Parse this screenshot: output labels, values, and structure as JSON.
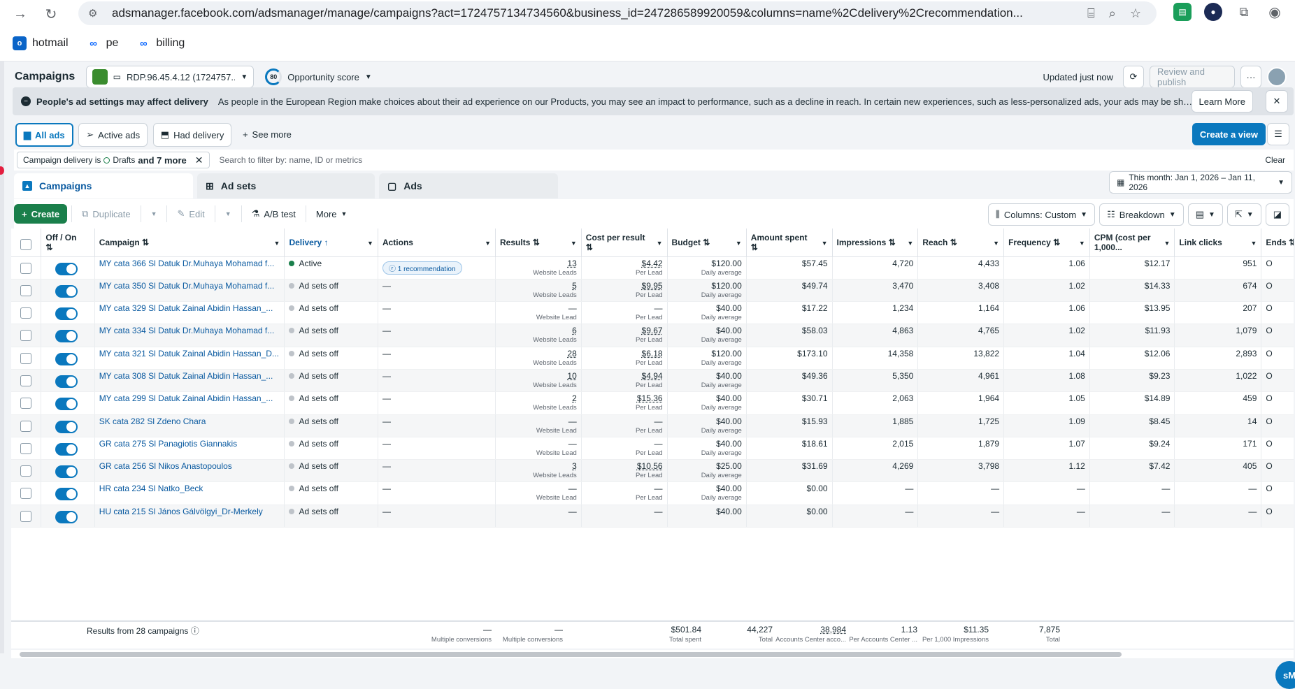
{
  "browser": {
    "url": "adsmanager.facebook.com/adsmanager/manage/campaigns?act=1724757134734560&business_id=247286589920059&columns=name%2Cdelivery%2Crecommendation...",
    "bookmarks": [
      "hotmail",
      "pe",
      "billing"
    ]
  },
  "topbar": {
    "title": "Campaigns",
    "account": "RDP.96.45.4.12 (1724757...",
    "opportunity_score_value": "80",
    "opportunity_label": "Opportunity score",
    "updated": "Updated just now",
    "review_publish": "Review and publish",
    "more": "···"
  },
  "banner": {
    "title": "People's ad settings may affect delivery",
    "text": "As people in the European Region make choices about their ad experience on our Products, you may see an impact to performance, such as a decline in reach. In certain new experiences, such as less-personalized ads, your ads may be shown in ad breaks, in which p...",
    "learn_more": "Learn More"
  },
  "views": {
    "all_ads": "All ads",
    "active_ads": "Active ads",
    "had_delivery": "Had delivery",
    "see_more": "See more",
    "create_view": "Create a view"
  },
  "filter": {
    "chip_prefix": "Campaign delivery is",
    "chip_value": "Drafts",
    "chip_more": "and 7 more",
    "search_placeholder": "Search to filter by: name, ID or metrics",
    "clear": "Clear"
  },
  "tabs": {
    "campaigns": "Campaigns",
    "ad_sets": "Ad sets",
    "ads": "Ads",
    "date_range": "This month: Jan 1, 2026 – Jan 11, 2026"
  },
  "toolbar": {
    "create": "Create",
    "duplicate": "Duplicate",
    "edit": "Edit",
    "ab_test": "A/B test",
    "more": "More",
    "columns": "Columns: Custom",
    "breakdown": "Breakdown"
  },
  "columns": [
    "Off / On",
    "Campaign",
    "Delivery",
    "Actions",
    "Results",
    "Cost per result",
    "Budget",
    "Amount spent",
    "Impressions",
    "Reach",
    "Frequency",
    "CPM (cost per 1,000...",
    "Link clicks",
    "Ends"
  ],
  "rows": [
    {
      "name": "MY cata 366 Sl Datuk Dr.Muhaya Mohamad f...",
      "delivery": "Active",
      "action": "1 recommendation",
      "results": "13",
      "results_sub": "Website Leads",
      "cpr": "$4.42",
      "cpr_sub": "Per Lead",
      "budget": "$120.00",
      "budget_sub": "Daily average",
      "spent": "$57.45",
      "impr": "4,720",
      "reach": "4,433",
      "freq": "1.06",
      "cpm": "$12.17",
      "clicks": "951",
      "ends": "O"
    },
    {
      "name": "MY cata 350 Sl Datuk Dr.Muhaya Mohamad f...",
      "delivery": "Ad sets off",
      "action": "—",
      "results": "5",
      "results_sub": "Website Leads",
      "cpr": "$9.95",
      "cpr_sub": "Per Lead",
      "budget": "$120.00",
      "budget_sub": "Daily average",
      "spent": "$49.74",
      "impr": "3,470",
      "reach": "3,408",
      "freq": "1.02",
      "cpm": "$14.33",
      "clicks": "674",
      "ends": "O"
    },
    {
      "name": "MY cata 329 Sl Datuk Zainal Abidin Hassan_...",
      "delivery": "Ad sets off",
      "action": "—",
      "results": "—",
      "results_sub": "Website Lead",
      "cpr": "—",
      "cpr_sub": "Per Lead",
      "budget": "$40.00",
      "budget_sub": "Daily average",
      "spent": "$17.22",
      "impr": "1,234",
      "reach": "1,164",
      "freq": "1.06",
      "cpm": "$13.95",
      "clicks": "207",
      "ends": "O"
    },
    {
      "name": "MY cata 334 Sl Datuk Dr.Muhaya Mohamad f...",
      "delivery": "Ad sets off",
      "action": "—",
      "results": "6",
      "results_sub": "Website Leads",
      "cpr": "$9.67",
      "cpr_sub": "Per Lead",
      "budget": "$40.00",
      "budget_sub": "Daily average",
      "spent": "$58.03",
      "impr": "4,863",
      "reach": "4,765",
      "freq": "1.02",
      "cpm": "$11.93",
      "clicks": "1,079",
      "ends": "O"
    },
    {
      "name": "MY cata 321 Sl Datuk Zainal Abidin Hassan_D...",
      "delivery": "Ad sets off",
      "action": "—",
      "results": "28",
      "results_sub": "Website Leads",
      "cpr": "$6.18",
      "cpr_sub": "Per Lead",
      "budget": "$120.00",
      "budget_sub": "Daily average",
      "spent": "$173.10",
      "impr": "14,358",
      "reach": "13,822",
      "freq": "1.04",
      "cpm": "$12.06",
      "clicks": "2,893",
      "ends": "O"
    },
    {
      "name": "MY cata 308 Sl Datuk Zainal Abidin Hassan_...",
      "delivery": "Ad sets off",
      "action": "—",
      "results": "10",
      "results_sub": "Website Leads",
      "cpr": "$4.94",
      "cpr_sub": "Per Lead",
      "budget": "$40.00",
      "budget_sub": "Daily average",
      "spent": "$49.36",
      "impr": "5,350",
      "reach": "4,961",
      "freq": "1.08",
      "cpm": "$9.23",
      "clicks": "1,022",
      "ends": "O"
    },
    {
      "name": "MY cata 299 Sl Datuk Zainal Abidin Hassan_...",
      "delivery": "Ad sets off",
      "action": "—",
      "results": "2",
      "results_sub": "Website Leads",
      "cpr": "$15.36",
      "cpr_sub": "Per Lead",
      "budget": "$40.00",
      "budget_sub": "Daily average",
      "spent": "$30.71",
      "impr": "2,063",
      "reach": "1,964",
      "freq": "1.05",
      "cpm": "$14.89",
      "clicks": "459",
      "ends": "O"
    },
    {
      "name": "SK cata 282 Sl Zdeno Chara",
      "delivery": "Ad sets off",
      "action": "—",
      "results": "—",
      "results_sub": "Website Lead",
      "cpr": "—",
      "cpr_sub": "Per Lead",
      "budget": "$40.00",
      "budget_sub": "Daily average",
      "spent": "$15.93",
      "impr": "1,885",
      "reach": "1,725",
      "freq": "1.09",
      "cpm": "$8.45",
      "clicks": "14",
      "ends": "O"
    },
    {
      "name": "GR cata 275 Sl Panagiotis Giannakis",
      "delivery": "Ad sets off",
      "action": "—",
      "results": "—",
      "results_sub": "Website Lead",
      "cpr": "—",
      "cpr_sub": "Per Lead",
      "budget": "$40.00",
      "budget_sub": "Daily average",
      "spent": "$18.61",
      "impr": "2,015",
      "reach": "1,879",
      "freq": "1.07",
      "cpm": "$9.24",
      "clicks": "171",
      "ends": "O"
    },
    {
      "name": "GR cata 256 Sl Nikos Anastopoulos",
      "delivery": "Ad sets off",
      "action": "—",
      "results": "3",
      "results_sub": "Website Leads",
      "cpr": "$10.56",
      "cpr_sub": "Per Lead",
      "budget": "$25.00",
      "budget_sub": "Daily average",
      "spent": "$31.69",
      "impr": "4,269",
      "reach": "3,798",
      "freq": "1.12",
      "cpm": "$7.42",
      "clicks": "405",
      "ends": "O"
    },
    {
      "name": "HR cata 234 Sl Natko_Beck",
      "delivery": "Ad sets off",
      "action": "—",
      "results": "—",
      "results_sub": "Website Lead",
      "cpr": "—",
      "cpr_sub": "Per Lead",
      "budget": "$40.00",
      "budget_sub": "Daily average",
      "spent": "$0.00",
      "impr": "—",
      "reach": "—",
      "freq": "—",
      "cpm": "—",
      "clicks": "—",
      "ends": "O"
    },
    {
      "name": "HU cata 215 Sl János Gálvölgyi_Dr-Merkely",
      "delivery": "Ad sets off",
      "action": "—",
      "results": "—",
      "results_sub": "",
      "cpr": "—",
      "cpr_sub": "",
      "budget": "$40.00",
      "budget_sub": "",
      "spent": "$0.00",
      "impr": "—",
      "reach": "—",
      "freq": "—",
      "cpm": "—",
      "clicks": "—",
      "ends": "O"
    }
  ],
  "totals": {
    "label": "Results from 28 campaigns",
    "results": "—",
    "results_sub": "Multiple conversions",
    "cpr": "—",
    "cpr_sub": "Multiple conversions",
    "spent": "$501.84",
    "spent_sub": "Total spent",
    "impr": "44,227",
    "impr_sub": "Total",
    "reach": "38,984",
    "reach_sub": "Accounts Center acco...",
    "freq": "1.13",
    "freq_sub": "Per Accounts Center ...",
    "cpm": "$11.35",
    "cpm_sub": "Per 1,000 Impressions",
    "clicks": "7,875",
    "clicks_sub": "Total"
  }
}
